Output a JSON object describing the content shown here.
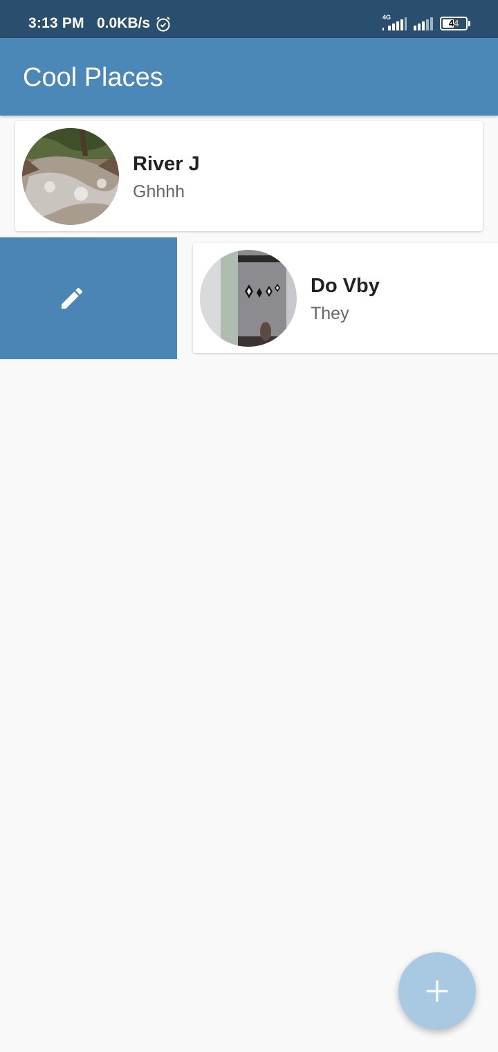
{
  "status_bar": {
    "time": "3:13 PM",
    "speed": "0.0KB/s",
    "network_type": "4G",
    "battery": "44",
    "icons": [
      "alarm-icon",
      "signal-icon",
      "signal-icon",
      "battery-icon"
    ]
  },
  "app_bar": {
    "title": "Cool Places"
  },
  "places": [
    {
      "title": "River J",
      "subtitle": "Ghhhh",
      "image": "river-photo"
    },
    {
      "title": "Do Vby",
      "subtitle": "They",
      "image": "curtain-photo"
    }
  ],
  "swipe_action": {
    "icon": "edit-icon"
  },
  "fab": {
    "icon": "plus-icon"
  },
  "colors": {
    "status_bar": "#2a4f6e",
    "app_bar": "#4b88b7",
    "swipe_action": "#4b85b5",
    "fab": "#a9c9e3",
    "background": "#f9f9f9"
  }
}
